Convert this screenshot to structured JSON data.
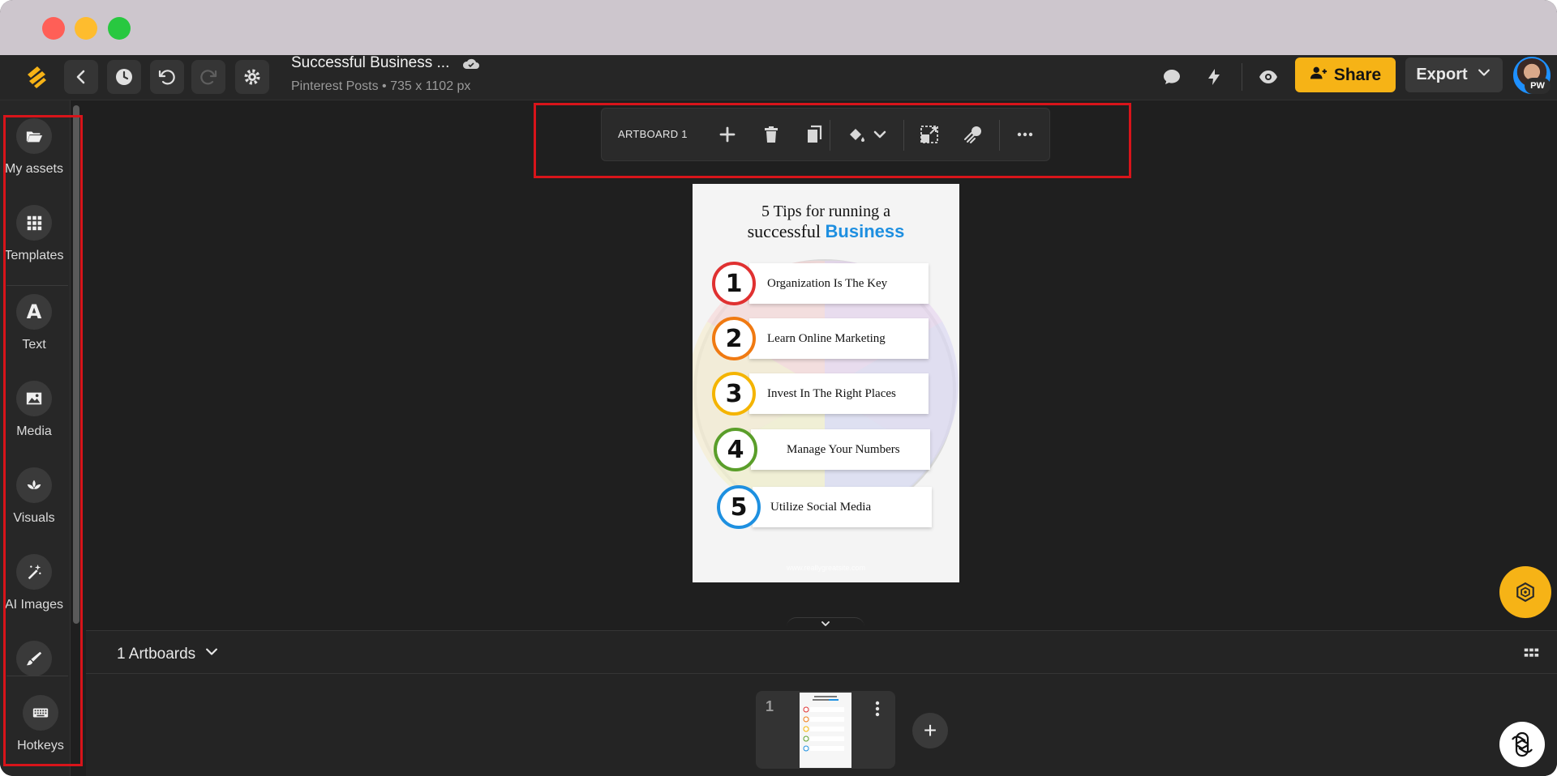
{
  "titlebar": {
    "controls": [
      "close",
      "minimize",
      "zoom"
    ]
  },
  "header": {
    "document_title": "Successful Business ...",
    "document_subtitle": "Pinterest Posts • 735 x 1102 px",
    "share_label": "Share",
    "export_label": "Export",
    "avatar_initials": "PW",
    "icons": [
      "logo-icon",
      "back-icon",
      "history-icon",
      "undo-icon",
      "redo-icon",
      "settings-icon",
      "cloud-saved-icon",
      "comment-icon",
      "lightning-icon",
      "preview-eye-icon",
      "add-user-icon",
      "chevron-down-icon"
    ]
  },
  "sidebar": {
    "items": [
      {
        "label": "My assets",
        "icon": "folder-open-icon"
      },
      {
        "label": "Templates",
        "icon": "grid-icon"
      },
      {
        "label": "Text",
        "icon": "text-a-icon"
      },
      {
        "label": "Media",
        "icon": "image-icon"
      },
      {
        "label": "Visuals",
        "icon": "lotus-icon"
      },
      {
        "label": "AI Images",
        "icon": "magic-wand-icon"
      },
      {
        "label": "",
        "icon": "brush-icon"
      },
      {
        "label": "Hotkeys",
        "icon": "keyboard-icon"
      }
    ]
  },
  "toolbar": {
    "artboard_label": "ARTBOARD 1",
    "icons": [
      "add-icon",
      "delete-icon",
      "duplicate-icon",
      "fill-icon",
      "chevron-down-icon",
      "resize-icon",
      "magic-resize-icon",
      "more-icon"
    ]
  },
  "artboard": {
    "title_line1": "5 Tips for running a",
    "title_line2_plain": "successful",
    "title_line2_highlight": "Business",
    "highlight_color": "#1e8fe0",
    "tips": [
      {
        "number": "1",
        "text": "Organization Is The Key",
        "color": "#e03131"
      },
      {
        "number": "2",
        "text": "Learn Online Marketing",
        "color": "#f07a12"
      },
      {
        "number": "3",
        "text": "Invest In The Right Places",
        "color": "#f4b400"
      },
      {
        "number": "4",
        "text": "Manage Your Numbers",
        "color": "#5a9e2a"
      },
      {
        "number": "5",
        "text": "Utilize Social Media",
        "color": "#1e90e0"
      }
    ],
    "footer": "www.reallygreatsite.com"
  },
  "bottom_panel": {
    "artboards_label": "1 Artboards",
    "thumbnail_number": "1",
    "add_label": "+"
  },
  "colors": {
    "accent": "#f6b316",
    "annotation_red": "#d8141a",
    "background": "#1f1f1f"
  }
}
